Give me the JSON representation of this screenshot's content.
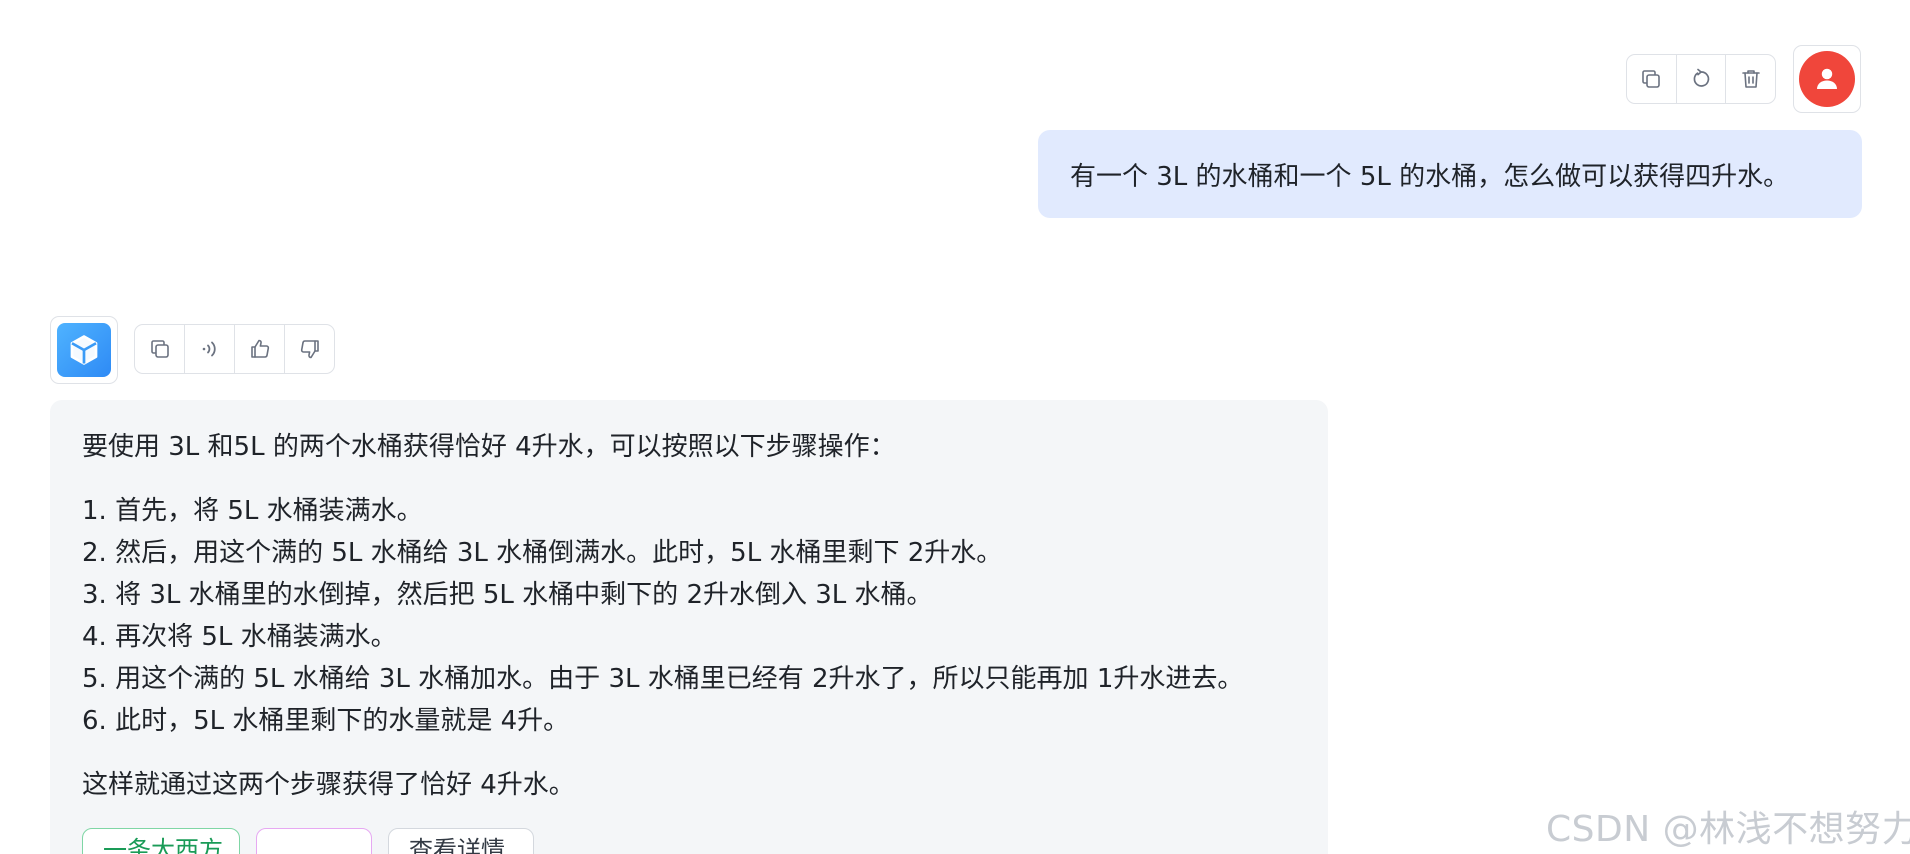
{
  "user_message": {
    "text": "有一个 3L 的水桶和一个 5L 的水桶，怎么做可以获得四升水。",
    "toolbar": [
      "copy-icon",
      "regenerate-icon",
      "delete-icon"
    ],
    "avatar_icon": "user-icon",
    "avatar_color": "#f0463b",
    "bubble_color": "#e1eafe"
  },
  "bot_message": {
    "avatar_icon": "cube-icon",
    "toolbar": [
      "copy-icon",
      "speaker-icon",
      "thumbs-up-icon",
      "thumbs-down-icon"
    ],
    "intro": "要使用 3L 和5L 的两个水桶获得恰好 4升水，可以按照以下步骤操作：",
    "steps": [
      "1. 首先，将 5L 水桶装满水。",
      "2. 然后，用这个满的 5L 水桶给 3L 水桶倒满水。此时，5L 水桶里剩下 2升水。",
      "3. 将 3L 水桶里的水倒掉，然后把 5L 水桶中剩下的 2升水倒入 3L 水桶。",
      "4. 再次将 5L 水桶装满水。",
      "5. 用这个满的 5L 水桶给 3L 水桶加水。由于 3L 水桶里已经有 2升水了，所以只能再加 1升水进去。",
      "6. 此时，5L 水桶里剩下的水量就是 4升。"
    ],
    "outro": "这样就通过这两个步骤获得了恰好 4升水。",
    "chips": {
      "first": "一条大西方",
      "second": "",
      "third": "查看详情"
    },
    "bubble_color": "#f4f6f8"
  },
  "watermark": "CSDN @林浅不想努力"
}
